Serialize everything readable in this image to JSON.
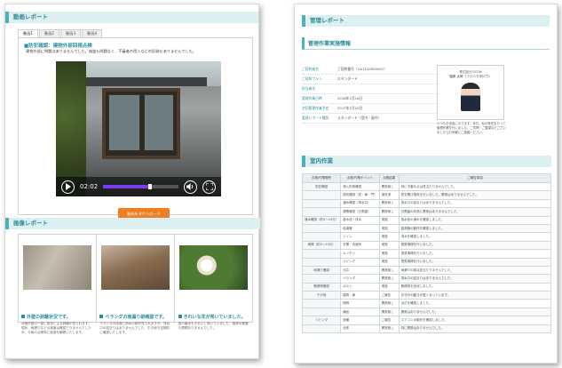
{
  "left_page": {
    "video_section_title": "動画レポート",
    "tabs": [
      "動画1",
      "動画2",
      "動画3",
      "動画4"
    ],
    "notice_title": "■防犯確認：建物外部回視点検",
    "notice_text": "建物外部に問題はありませんでした。施錠も問題なく、不審者の侵入などの形跡もありませんでした。",
    "video": {
      "time": "02:02",
      "progress": 0.62
    },
    "download_label": "動画をダウンロード",
    "photo_section_title": "画像レポート",
    "photos": [
      {
        "title": "外壁の剥離状況です。",
        "text": "北側外壁の一部に経年による剥離が見られます。現状、雨漏りなどの被害は確認できませんでしたが、今後の点検時に経過を観察いたします。"
      },
      {
        "title": "ベランダの雨漏り跡確認です。",
        "text": "ベランダの床面に雨水の跡が見られますが、排水口の詰まりはありませんでした。引き続き定期的に確認いたします。"
      },
      {
        "title": "きれいな花が咲いていました。",
        "text": "庭の植木もきれいに咲いていました。雑草の繁殖も問題ありませんでした。"
      }
    ]
  },
  "right_page": {
    "title": "管理レポート",
    "info_section_title": "管理作業実施情報",
    "info": [
      {
        "label": "ご契約者名",
        "value": "ご契約番号（CA1120000001）"
      },
      {
        "label": "ご契約プラン",
        "value": "スタンダード"
      },
      {
        "label": "担当者名",
        "value": ""
      },
      {
        "label": "管理作業日時",
        "value": "2018年1月18日"
      },
      {
        "label": "次回管理作業予定",
        "value": "2017年1月29日"
      },
      {
        "label": "管理レポート種別",
        "value": "スタンダード（室内・屋外）"
      }
    ],
    "card": {
      "company": "株式会社COCOM",
      "name": "福原 太郎（フクハラタロウ）"
    },
    "card_message": "いつもお世話になります。本日、私が責任をもって管理作業を行いました。ご質問・ご要望などございましたらお気軽にご連絡ください。",
    "work_section_title": "室内作業",
    "table_headers": [
      "点検/作業箇所",
      "点検/作業ポイント",
      "点検結果",
      "ご報告事項"
    ],
    "table_rows": [
      {
        "area": "防犯確認",
        "point": "侵入形跡確認",
        "result": "異常無し",
        "note": "特に不審な点は見当たりませんでした。"
      },
      {
        "area": "",
        "point": "換気確認（窓・扉・門）",
        "result": "換気済",
        "note": "窓を開け換気を行いました。異常はありませんでした。"
      },
      {
        "area": "",
        "point": "通水確認（排水口）",
        "result": "異常無し",
        "note": "排水口の詰まりはありませんでした。"
      },
      {
        "area": "",
        "point": "漏電確認（分電盤）",
        "result": "異常無し",
        "note": "分電盤の状態に異常はありませんでした。"
      },
      {
        "area": "通水確認（約5〜10分）",
        "point": "各水栓・排水",
        "result": "実施",
        "note": "各水栓の通水を確認しました。"
      },
      {
        "area": "",
        "point": "給湯器",
        "result": "実施",
        "note": "給湯器の動作を確認しました。"
      },
      {
        "area": "",
        "point": "トイレ",
        "result": "実施",
        "note": "流水を確認しました。"
      },
      {
        "area": "清掃（約5〜10分）",
        "point": "玄関・洗面所",
        "result": "実施",
        "note": "簡易清掃を行いました。"
      },
      {
        "area": "",
        "point": "キッチン",
        "result": "実施",
        "note": "簡易清掃を行いました。"
      },
      {
        "area": "",
        "point": "リビング",
        "result": "実施",
        "note": "簡易清掃を行いました。"
      },
      {
        "area": "雨漏り確認",
        "point": "天井",
        "result": "異常無し",
        "note": "雨漏りの跡は見当たりませんでした。"
      },
      {
        "area": "",
        "point": "ベランダ",
        "result": "異常無し",
        "note": "排水口の詰まりはありませんでした。"
      },
      {
        "area": "郵便物確認",
        "point": "ポスト",
        "result": "実施",
        "note": "郵便物を回収しました。"
      },
      {
        "area": "その他",
        "point": "建具・扉",
        "result": "ご報告",
        "note": "引き戸の動きが重くなっています。"
      },
      {
        "area": "",
        "point": "照明",
        "result": "異常無し",
        "note": "点灯を確認しました。"
      },
      {
        "area": "",
        "point": "備品",
        "result": "異常無し",
        "note": "異常はありませんでした。"
      },
      {
        "area": "リビング",
        "point": "設備",
        "result": "ご報告",
        "note": "エアコンの動作を確認しました。"
      },
      {
        "area": "",
        "point": "全体",
        "result": "異常無し",
        "note": "特に問題はありませんでした。"
      }
    ]
  },
  "colors": {
    "accent": "#2c8f9c",
    "head_bg": "#dceff1",
    "button": "#f07e22",
    "progress": "#7a3cf0"
  }
}
